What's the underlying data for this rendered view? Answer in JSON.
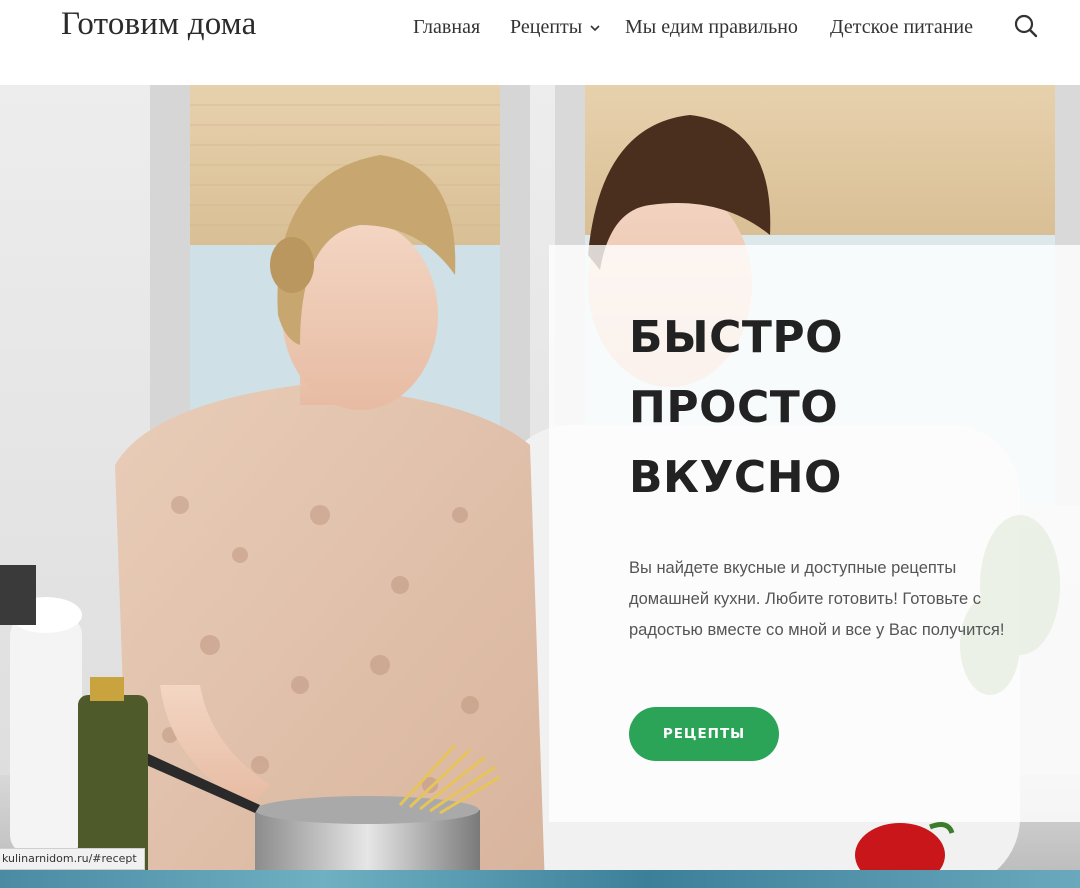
{
  "header": {
    "site_title": "Готовим дома",
    "nav": [
      {
        "label": "Главная"
      },
      {
        "label": "Рецепты",
        "has_dropdown": true
      },
      {
        "label": "Мы едим правильно"
      },
      {
        "label": "Детское питание"
      }
    ],
    "search_icon": "search-icon"
  },
  "hero": {
    "title_lines": [
      "БЫСТРО",
      "ПРОСТО",
      "ВКУСНО"
    ],
    "text": "Вы найдете вкусные и доступные рецепты домашней кухни. Любите готовить! Готовьте с радостью вместе со мной и все у Вас получится!",
    "button_label": "РЕЦЕПТЫ",
    "button_color": "#2ba457",
    "image_description": "couple-cooking-in-kitchen"
  },
  "status_bar": {
    "url": "kulinarnidom.ru/#recept"
  },
  "colors": {
    "accent": "#2ba457",
    "title_text": "#222222",
    "body_text": "#555555"
  }
}
